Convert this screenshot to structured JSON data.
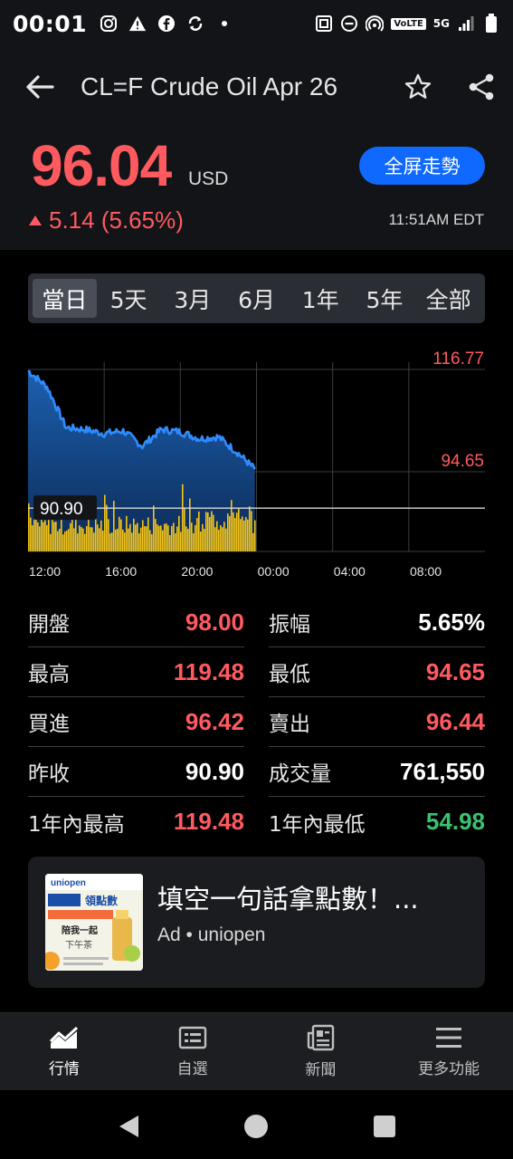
{
  "status_bar": {
    "time": "00:01",
    "volte": "VoLTE",
    "network": "5G"
  },
  "header": {
    "title": "CL=F Crude Oil Apr 26",
    "price": "96.04",
    "currency": "USD",
    "change": "5.14 (5.65%)",
    "fullscreen_label": "全屏走勢",
    "update_time": "11:51AM EDT"
  },
  "tabs": [
    {
      "label": "當日",
      "active": true
    },
    {
      "label": "5天"
    },
    {
      "label": "3月"
    },
    {
      "label": "6月"
    },
    {
      "label": "1年"
    },
    {
      "label": "5年"
    },
    {
      "label": "全部"
    }
  ],
  "chart": {
    "y_high_label": "116.77",
    "y_low_label": "94.65",
    "prev_close_label": "90.90",
    "x_ticks": [
      "12:00",
      "16:00",
      "20:00",
      "00:00",
      "04:00",
      "08:00"
    ]
  },
  "chart_data": {
    "type": "area",
    "x_ticks": [
      "12:00",
      "16:00",
      "20:00",
      "00:00",
      "04:00",
      "08:00"
    ],
    "y_labels": [
      116.77,
      94.65
    ],
    "reference_line": 90.9,
    "series": [
      {
        "x": [
          "12:00",
          "13:00",
          "14:00",
          "15:00",
          "16:00",
          "17:00",
          "18:00",
          "19:00",
          "20:00",
          "21:00",
          "22:00",
          "23:00",
          "23:55"
        ],
        "values": [
          116.5,
          113.0,
          104.2,
          103.8,
          102.9,
          103.5,
          100.2,
          103.8,
          103.3,
          101.8,
          102.2,
          98.8,
          95.2
        ]
      }
    ]
  },
  "stats": [
    [
      {
        "label": "開盤",
        "value": "98.00",
        "color": "red"
      },
      {
        "label": "振幅",
        "value": "5.65%",
        "color": "white"
      }
    ],
    [
      {
        "label": "最高",
        "value": "119.48",
        "color": "red"
      },
      {
        "label": "最低",
        "value": "94.65",
        "color": "red"
      }
    ],
    [
      {
        "label": "買進",
        "value": "96.42",
        "color": "red"
      },
      {
        "label": "賣出",
        "value": "96.44",
        "color": "red"
      }
    ],
    [
      {
        "label": "昨收",
        "value": "90.90",
        "color": "white"
      },
      {
        "label": "成交量",
        "value": "761,550",
        "color": "white"
      }
    ],
    [
      {
        "label": "1年內最高",
        "value": "119.48",
        "color": "red"
      },
      {
        "label": "1年內最低",
        "value": "54.98",
        "color": "green"
      }
    ]
  ],
  "ad": {
    "title": "填空一句話拿點數！...",
    "meta": "Ad • uniopen",
    "img_brand": "uniopen",
    "img_headline": "領點數",
    "img_line2": "陪我一起",
    "img_line3": "下午茶"
  },
  "bottom_nav": [
    {
      "label": "行情",
      "icon": "market-chart-icon",
      "active": true
    },
    {
      "label": "自選",
      "icon": "watchlist-icon"
    },
    {
      "label": "新聞",
      "icon": "news-icon"
    },
    {
      "label": "更多功能",
      "icon": "menu-icon"
    }
  ],
  "colors": {
    "up": "#ff5a5f",
    "down": "#3ac270",
    "accent": "#0f69ff",
    "price_line": "#2f8cff",
    "volume": "#f5c518"
  }
}
